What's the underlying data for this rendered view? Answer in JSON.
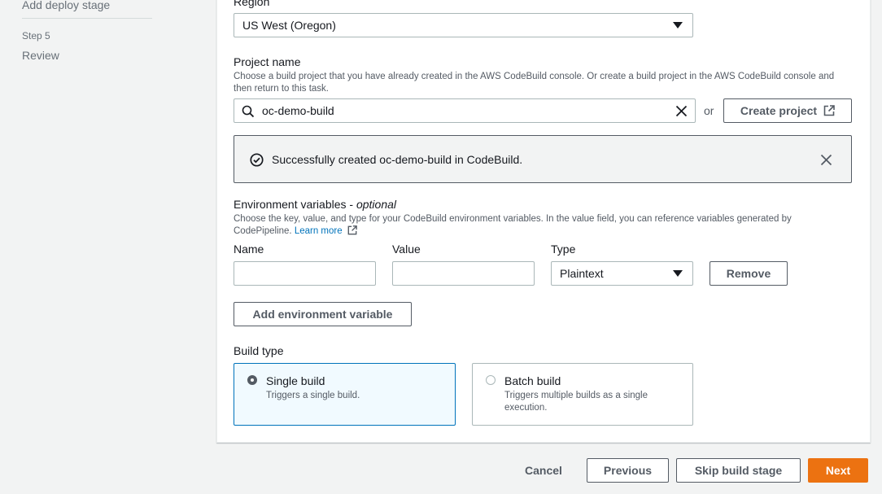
{
  "sidebar": {
    "items": [
      {
        "label": "Add deploy stage"
      },
      {
        "step": "Step 5",
        "label": "Review"
      }
    ]
  },
  "region": {
    "label": "Region",
    "value": "US West (Oregon)"
  },
  "project": {
    "label": "Project name",
    "description": "Choose a build project that you have already created in the AWS CodeBuild console. Or create a build project in the AWS CodeBuild console and then return to this task.",
    "search_value": "oc-demo-build",
    "or_text": "or",
    "create_label": "Create project"
  },
  "alert": {
    "message": "Successfully created oc-demo-build in CodeBuild."
  },
  "env": {
    "title": "Environment variables",
    "optional": "optional",
    "separator": " - ",
    "description": "Choose the key, value, and type for your CodeBuild environment variables. In the value field, you can reference variables generated by CodePipeline.",
    "learn_more": "Learn more",
    "name_label": "Name",
    "value_label": "Value",
    "type_label": "Type",
    "name_value": "",
    "value_value": "",
    "type_value": "Plaintext",
    "remove_label": "Remove",
    "add_label": "Add environment variable"
  },
  "build_type": {
    "label": "Build type",
    "options": [
      {
        "title": "Single build",
        "description": "Triggers a single build.",
        "selected": true
      },
      {
        "title": "Batch build",
        "description": "Triggers multiple builds as a single execution.",
        "selected": false
      }
    ]
  },
  "footer": {
    "cancel": "Cancel",
    "previous": "Previous",
    "skip": "Skip build stage",
    "next": "Next"
  },
  "colors": {
    "primary": "#ec7211",
    "link": "#0073bb",
    "selected_bg": "#f1faff",
    "text": "#16191f"
  },
  "icons": [
    "search-icon",
    "clear-icon",
    "external-link-icon",
    "success-check-icon",
    "close-icon",
    "chevron-down-icon"
  ]
}
